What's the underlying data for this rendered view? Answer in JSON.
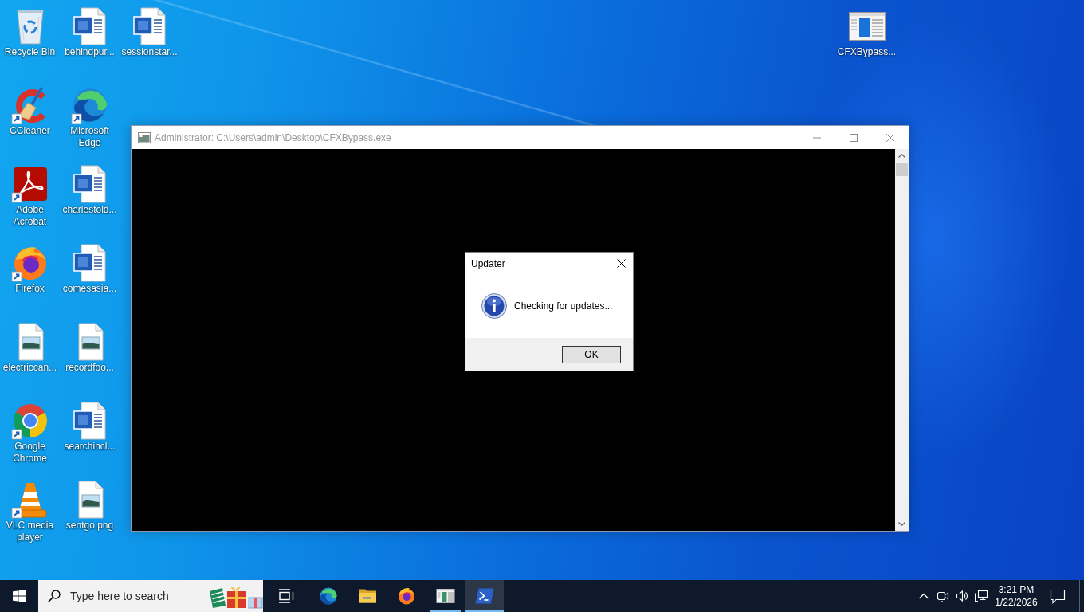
{
  "desktop": {
    "icon_columns": [
      [
        {
          "label": "Recycle Bin",
          "kind": "recyclebin",
          "shortcut": false
        },
        {
          "label": "CCleaner",
          "kind": "ccleaner",
          "shortcut": true
        },
        {
          "label": "Adobe Acrobat",
          "kind": "acrobat",
          "shortcut": true
        },
        {
          "label": "Firefox",
          "kind": "firefox",
          "shortcut": true
        },
        {
          "label": "electriccan...",
          "kind": "image",
          "shortcut": false
        },
        {
          "label": "Google Chrome",
          "kind": "chrome",
          "shortcut": true
        },
        {
          "label": "VLC media player",
          "kind": "vlc",
          "shortcut": true
        }
      ],
      [
        {
          "label": "behindpur...",
          "kind": "word",
          "shortcut": false
        },
        {
          "label": "Microsoft Edge",
          "kind": "edge",
          "shortcut": true
        },
        {
          "label": "charlestold...",
          "kind": "word",
          "shortcut": false
        },
        {
          "label": "comesasia...",
          "kind": "word",
          "shortcut": false
        },
        {
          "label": "recordfoo...",
          "kind": "image",
          "shortcut": false
        },
        {
          "label": "searchincl...",
          "kind": "word",
          "shortcut": false
        },
        {
          "label": "sentgo.png",
          "kind": "image",
          "shortcut": false
        }
      ],
      [
        {
          "label": "sessionstar...",
          "kind": "word",
          "shortcut": false
        }
      ]
    ],
    "corner_icons": [
      {
        "label": "CFXBypass...",
        "kind": "exe",
        "shortcut": false
      }
    ]
  },
  "console_window": {
    "title": "Administrator: C:\\Users\\admin\\Desktop\\CFXBypass.exe",
    "active": false
  },
  "dialog": {
    "title": "Updater",
    "active": true,
    "kind": "info",
    "message": "Checking for updates...",
    "buttons": [
      "OK"
    ]
  },
  "taskbar": {
    "search": {
      "placeholder": "Type here to search"
    },
    "apps": [
      {
        "kind": "edge",
        "running": false,
        "selected": false
      },
      {
        "kind": "explorer",
        "running": false,
        "selected": false
      },
      {
        "kind": "firefox",
        "running": false,
        "selected": false
      },
      {
        "kind": "exe",
        "running": true,
        "selected": false
      },
      {
        "kind": "terminal",
        "running": true,
        "selected": true
      }
    ],
    "clock": {
      "time": "3:21 PM",
      "date": "1/22/2026"
    }
  }
}
